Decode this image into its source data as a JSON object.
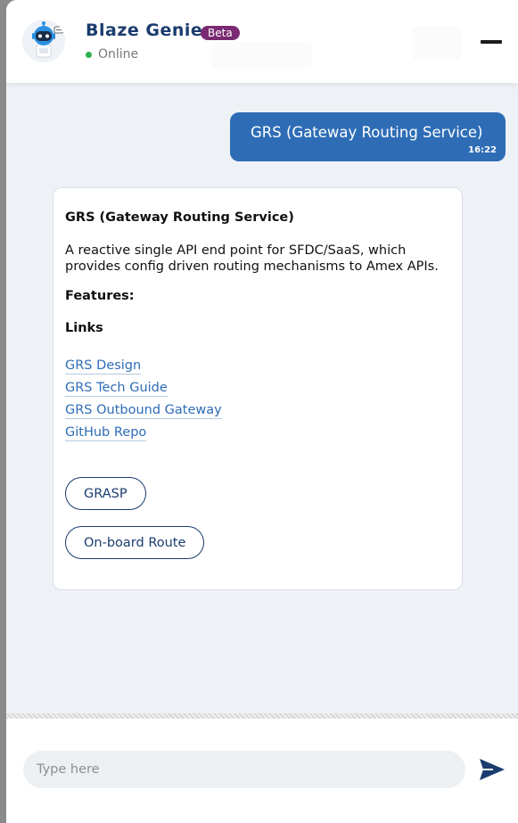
{
  "header": {
    "title": "Blaze Genie",
    "badge": "Beta",
    "status": "Online"
  },
  "conversation": {
    "user_message": {
      "text": "GRS (Gateway Routing Service)",
      "time": "16:22"
    },
    "bot_message": {
      "title": "GRS (Gateway Routing Service)",
      "description": "A reactive single API end point for SFDC/SaaS, which provides config driven routing mechanisms to Amex APIs.",
      "features_heading": "Features:",
      "links_heading": "Links",
      "links": [
        {
          "label": "GRS Design"
        },
        {
          "label": "GRS Tech Guide"
        },
        {
          "label": "GRS Outbound Gateway"
        },
        {
          "label": "GitHub Repo"
        }
      ],
      "buttons": [
        {
          "label": "GRASP"
        },
        {
          "label": "On-board Route"
        }
      ]
    }
  },
  "composer": {
    "placeholder": "Type here"
  },
  "colors": {
    "brand": "#1a3c6e",
    "accent": "#2e6db6",
    "badge": "#7a2a72",
    "online": "#2fb14e"
  },
  "icons": {
    "avatar": "robot-icon",
    "minimize": "minimize-icon",
    "send": "send-icon"
  }
}
